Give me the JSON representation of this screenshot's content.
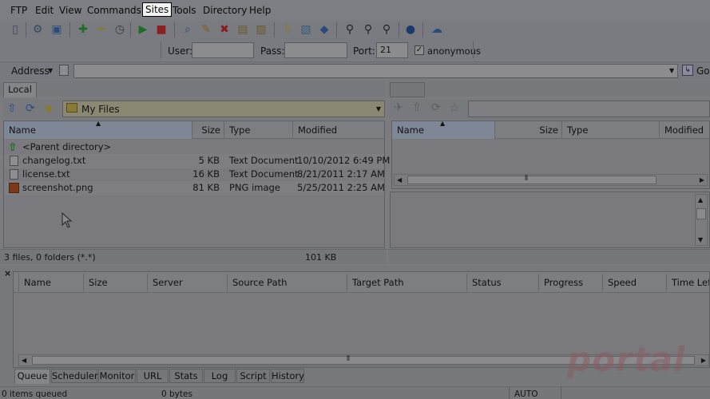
{
  "menu": [
    "FTP",
    "Edit",
    "View",
    "Commands",
    "Sites",
    "Tools",
    "Directory",
    "Help"
  ],
  "quick": {
    "user_label": "User:",
    "user_value": "",
    "pass_label": "Pass:",
    "pass_value": "",
    "port_label": "Port:",
    "port_value": "21",
    "anon_label": "anonymous",
    "anon_checked": "✓"
  },
  "address": {
    "label": "Address",
    "go": "Go"
  },
  "local": {
    "tab": "Local",
    "path": "My Files",
    "columns": [
      "Name",
      "Size",
      "Type",
      "Modified"
    ],
    "rows": [
      {
        "name": "<Parent directory>",
        "size": "",
        "type": "",
        "modified": ""
      },
      {
        "name": "changelog.txt",
        "size": "5 KB",
        "type": "Text Document",
        "modified": "10/10/2012 6:49 PM"
      },
      {
        "name": "license.txt",
        "size": "16 KB",
        "type": "Text Document",
        "modified": "8/21/2011 2:17 AM"
      },
      {
        "name": "screenshot.png",
        "size": "81 KB",
        "type": "PNG image",
        "modified": "5/25/2011 2:25 AM"
      }
    ],
    "status_left": "3 files, 0 folders (*.*)",
    "status_right": "101 KB"
  },
  "remote": {
    "columns": [
      "Name",
      "Size",
      "Type",
      "Modified"
    ]
  },
  "queue": {
    "close": "×",
    "columns": [
      "Name",
      "Size",
      "Server",
      "Source Path",
      "Target Path",
      "Status",
      "Progress",
      "Speed",
      "Time Lef"
    ],
    "tabs": [
      "Queue",
      "Scheduler",
      "Monitor",
      "URL",
      "Stats",
      "Log",
      "Script",
      "History"
    ]
  },
  "statusbar": {
    "items": "0 items queued",
    "bytes": "0 bytes",
    "mode": "AUTO"
  },
  "watermark": "portal"
}
